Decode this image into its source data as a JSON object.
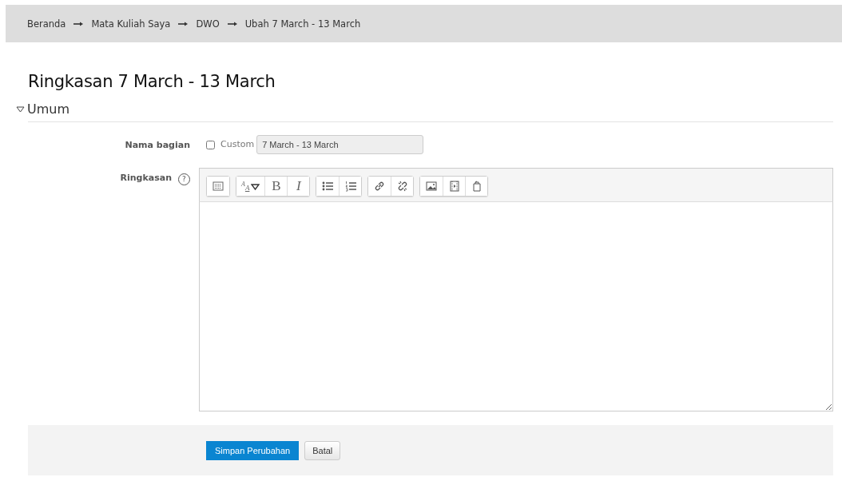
{
  "breadcrumb": [
    "Beranda",
    "Mata Kuliah Saya",
    "DWO",
    "Ubah 7 March - 13 March"
  ],
  "heading": "Ringkasan 7 March - 13 March",
  "section": {
    "title": "Umum",
    "expanded": true
  },
  "fields": [
    {
      "kind": "name",
      "label": "Nama bagian",
      "checkbox_label": "Custom",
      "checked": false,
      "value": "7 March - 13 March",
      "disabled": true
    },
    {
      "kind": "editor",
      "label": "Ringkasan",
      "help": "?",
      "toolbar": [
        [
          {
            "kind": "toggle"
          }
        ],
        [
          {
            "kind": "style",
            "labels": [
              "A",
              "A"
            ]
          },
          {
            "kind": "bold",
            "label": "B"
          },
          {
            "kind": "italic",
            "label": "I"
          }
        ],
        [
          {
            "kind": "bullets"
          },
          {
            "kind": "numbers"
          }
        ],
        [
          {
            "kind": "link"
          },
          {
            "kind": "unlink"
          }
        ],
        [
          {
            "kind": "image"
          },
          {
            "kind": "media"
          },
          {
            "kind": "paste"
          }
        ]
      ]
    }
  ],
  "buttons": [
    {
      "label": "Simpan Perubahan",
      "kind": "primary"
    },
    {
      "label": "Batal",
      "kind": "secondary"
    }
  ]
}
